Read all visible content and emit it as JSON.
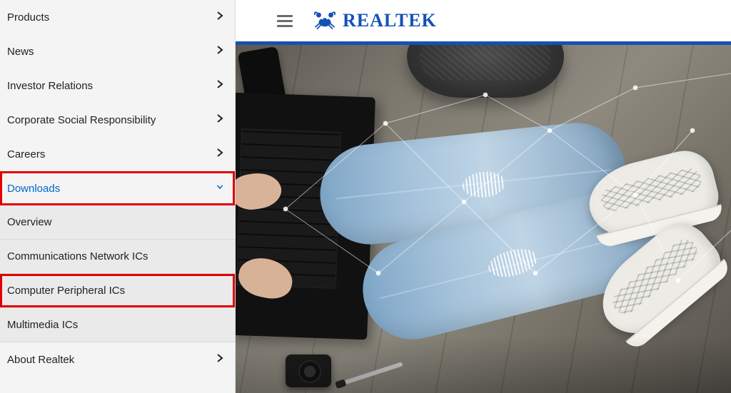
{
  "brand": {
    "name": "REALTEK"
  },
  "sidebar": {
    "items": [
      {
        "label": "Products",
        "expandable": true
      },
      {
        "label": "News",
        "expandable": true
      },
      {
        "label": "Investor Relations",
        "expandable": true
      },
      {
        "label": "Corporate Social Responsibility",
        "expandable": true
      },
      {
        "label": "Careers",
        "expandable": true
      },
      {
        "label": "Downloads",
        "expandable": true,
        "active": true,
        "highlighted": true
      },
      {
        "label": "Overview",
        "sub": true
      },
      {
        "label": "Communications Network ICs",
        "sub": true
      },
      {
        "label": "Computer Peripheral ICs",
        "sub": true,
        "highlighted": true
      },
      {
        "label": "Multimedia ICs",
        "sub": true
      },
      {
        "label": "About Realtek",
        "expandable": true
      }
    ]
  },
  "colors": {
    "brand_blue": "#1451b4",
    "highlight_red": "#e10000",
    "link_blue": "#0066cc"
  }
}
